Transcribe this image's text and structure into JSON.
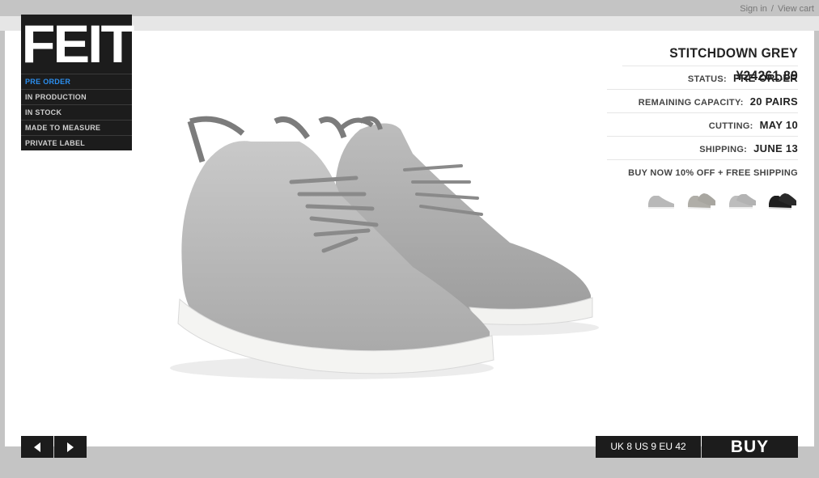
{
  "header": {
    "sign_in": "Sign in",
    "separator": "/",
    "view_cart": "View cart"
  },
  "brand": {
    "logo_text": "FEIT"
  },
  "nav": {
    "items": [
      {
        "label": "PRE ORDER",
        "active": true
      },
      {
        "label": "IN PRODUCTION",
        "active": false
      },
      {
        "label": "IN STOCK",
        "active": false
      },
      {
        "label": "MADE TO MEASURE",
        "active": false
      },
      {
        "label": "PRIVATE LABEL",
        "active": false
      }
    ]
  },
  "product": {
    "title": "STITCHDOWN GREY ¥24261.89",
    "status_label": "STATUS:",
    "status_value": "PRE ORDER",
    "capacity_label": "REMAINING CAPACITY:",
    "capacity_value": "20 PAIRS",
    "cutting_label": "CUTTING:",
    "cutting_value": "MAY 10",
    "shipping_label": "SHIPPING:",
    "shipping_value": "JUNE 13",
    "promo": "BUY NOW 10% OFF + FREE SHIPPING",
    "thumbnails": [
      {
        "name": "grey-side",
        "color": "#b8b8b8"
      },
      {
        "name": "grey-pair",
        "color": "#b0aea8"
      },
      {
        "name": "grey-front",
        "color": "#bdbdbd"
      },
      {
        "name": "black-pair",
        "color": "#1f1f1f"
      }
    ]
  },
  "purchase": {
    "size_label": "UK 8 US 9 EU 42",
    "buy_label": "BUY"
  },
  "colors": {
    "accent_nav": "#2b8ff0",
    "dark_panel": "#1c1c1c",
    "background": "#c4c4c4"
  }
}
